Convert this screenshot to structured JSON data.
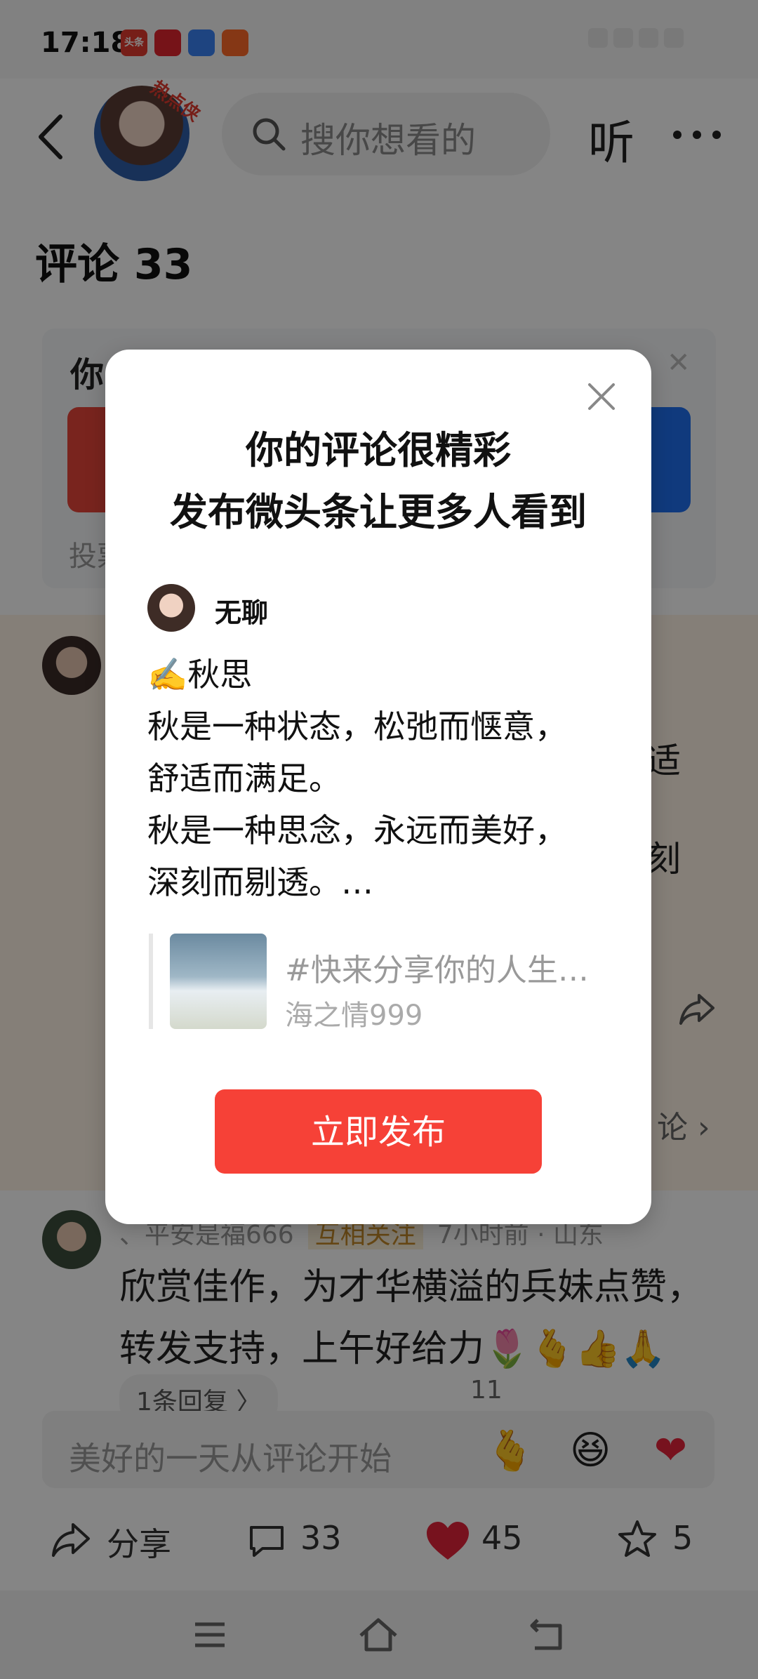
{
  "status_bar": {
    "time": "17:18",
    "app_badge_label": "头条"
  },
  "header": {
    "avatar_badge": "热点侠",
    "search_placeholder": "搜你想看的",
    "listen_label": "听"
  },
  "page": {
    "comments_title": "评论 33"
  },
  "background": {
    "card_title_partial": "你",
    "card_foot_partial": "投票",
    "peek_text_1": "适",
    "peek_text_2": "刻",
    "peek_more": "论 ›",
    "comment2": {
      "meta_user": "、平安是福666",
      "meta_tag": "互相关注",
      "meta_time": "7小时前 · 山东",
      "text_line1": "欣赏佳作，为才华横溢的兵妹点赞，",
      "text_line2": "转发支持，上午好",
      "emoji": "给力🌷🫰👍🙏",
      "reply_label": "1条回复 〉",
      "like_count": "11"
    }
  },
  "comment_input": {
    "placeholder": "美好的一天从评论开始",
    "emoji_1": "🫰",
    "emoji_2": "😆",
    "emoji_3": "❤"
  },
  "bottom_actions": {
    "share_label": "分享",
    "comments_count": "33",
    "likes_count": "45",
    "favorites_count": "5"
  },
  "dialog": {
    "title_line1": "你的评论很精彩",
    "title_line2": "发布微头条让更多人看到",
    "author": "无聊",
    "body": "✍️秋思\n秋是一种状态，松弛而惬意，\n舒适而满足。\n秋是一种思念，永远而美好，\n深刻而剔透。…",
    "quote_title": "#快来分享你的人生…",
    "quote_author": "海之情999",
    "publish_label": "立即发布"
  },
  "colors": {
    "accent_red": "#f64137",
    "like_red": "#e5233a",
    "blue": "#1f6ff0"
  }
}
